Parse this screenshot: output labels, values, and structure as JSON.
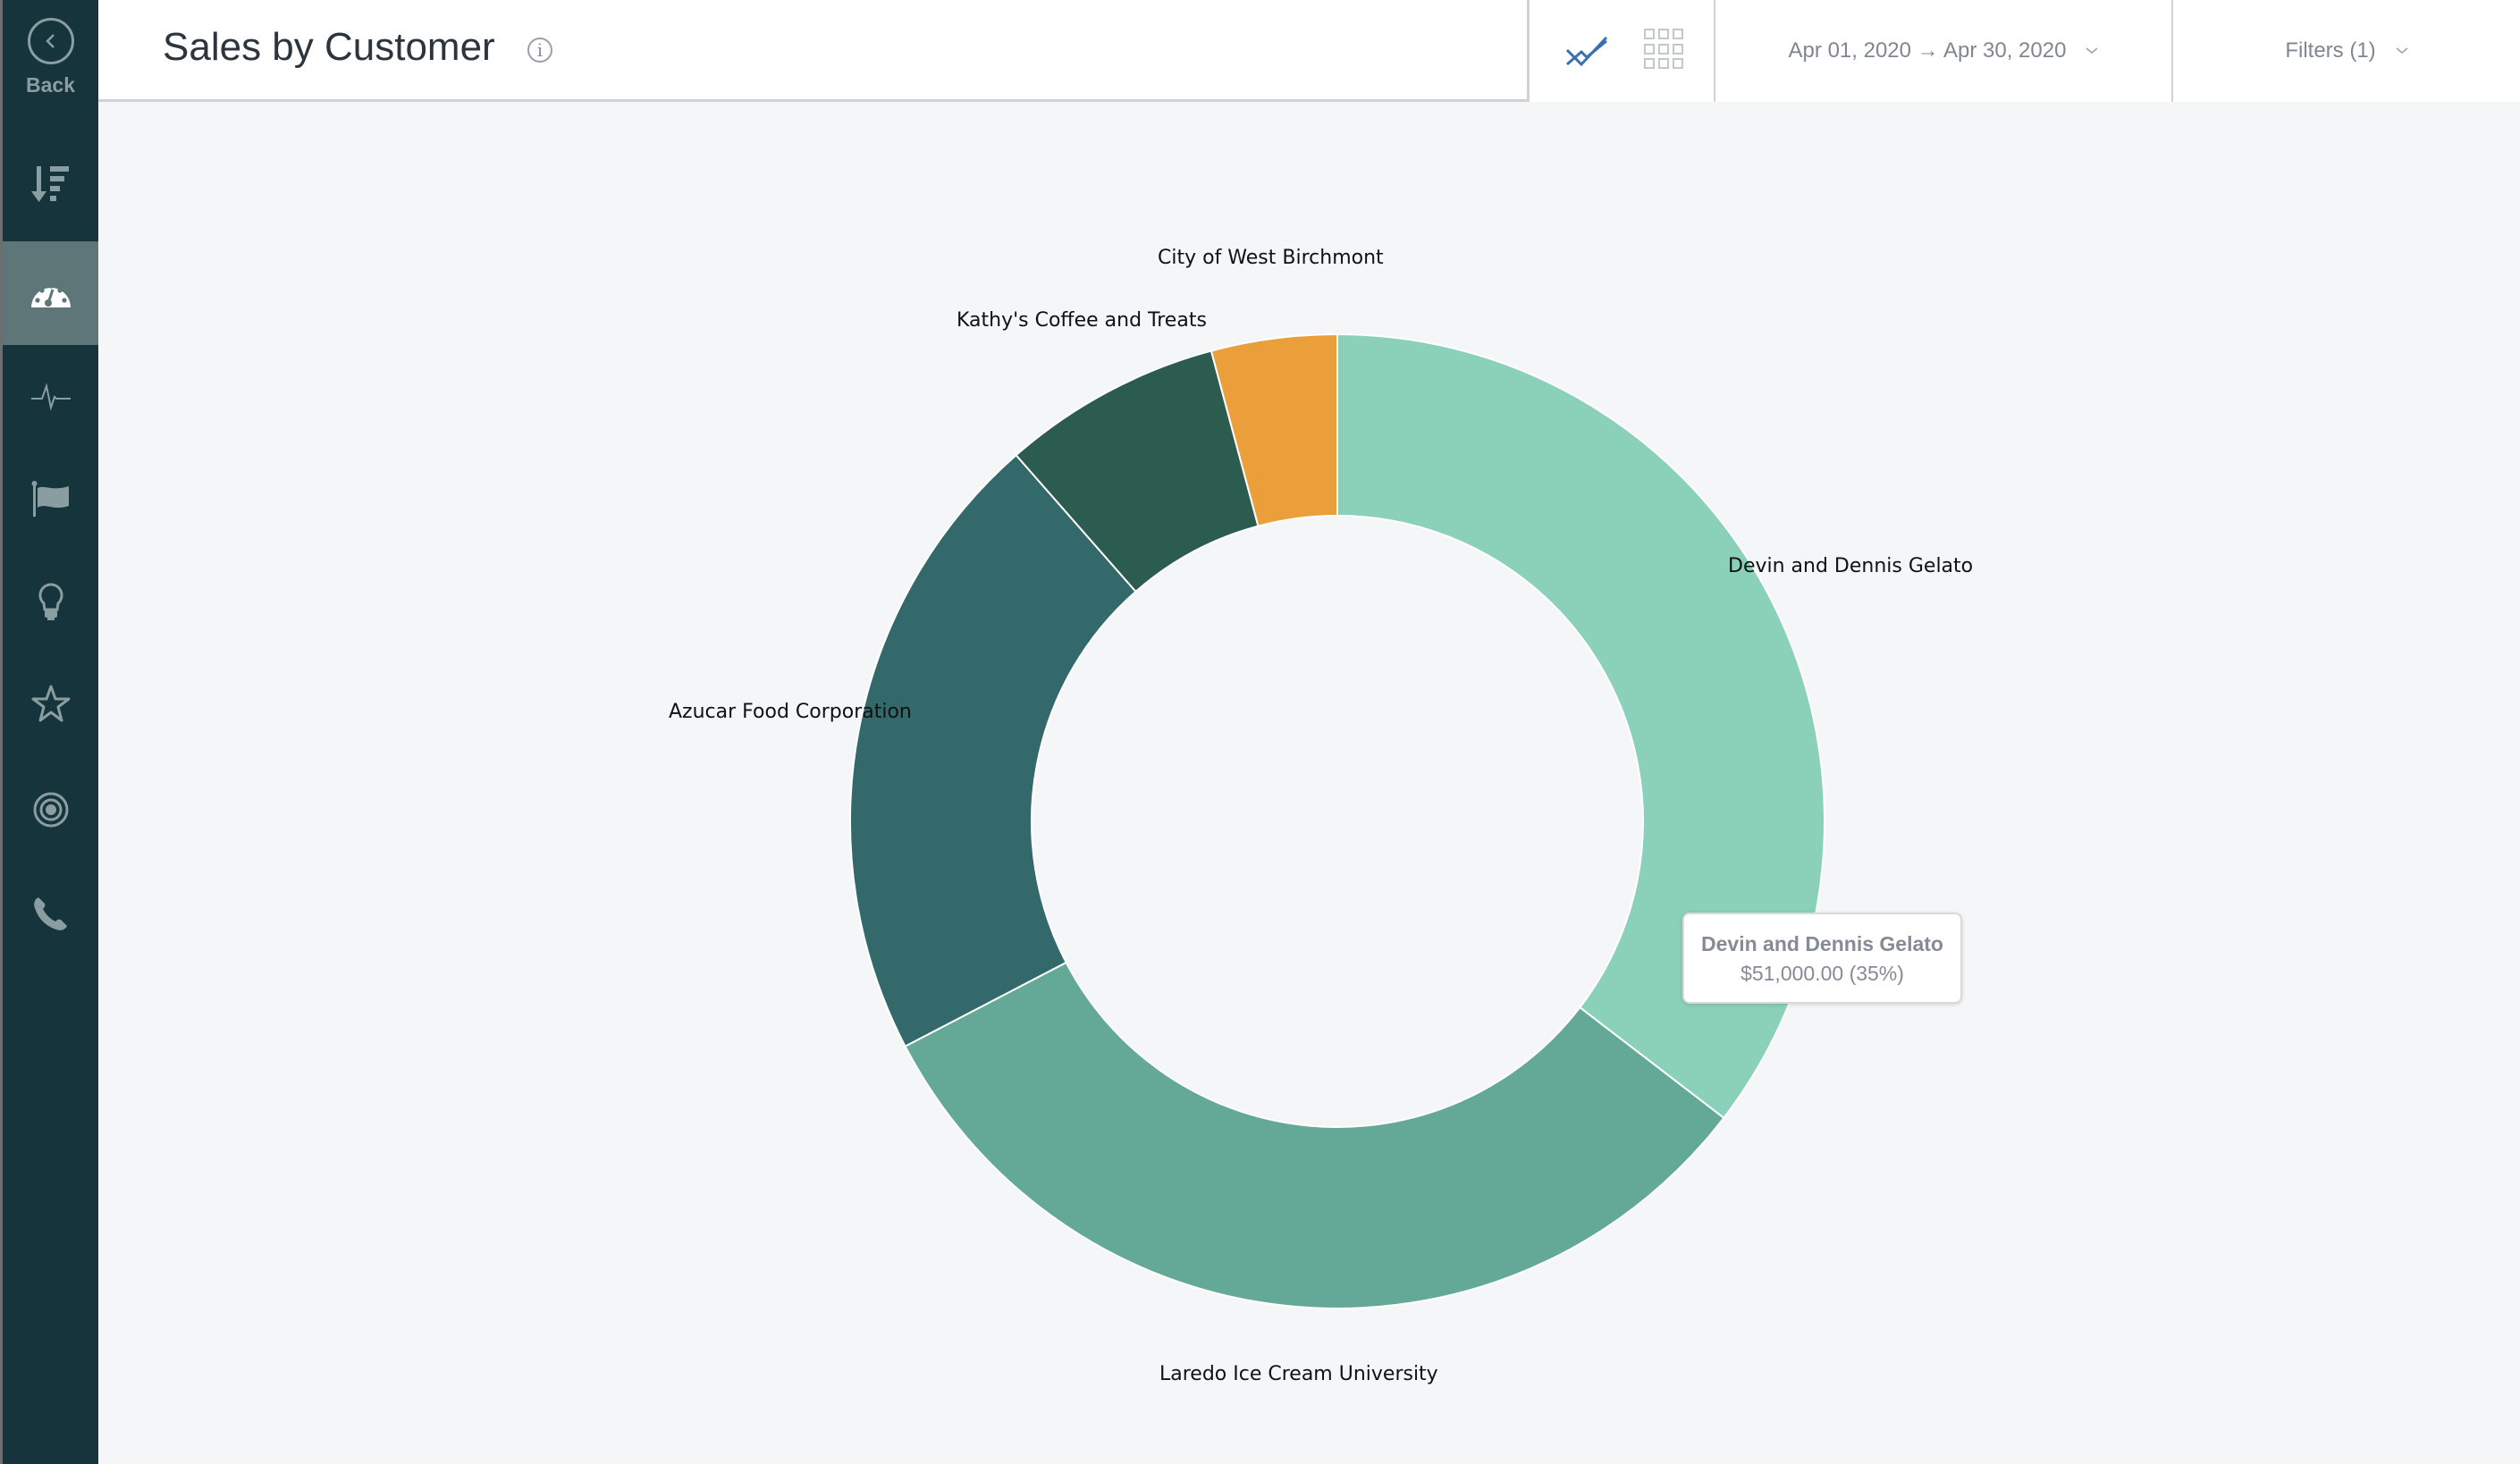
{
  "sidebar": {
    "back_label": "Back",
    "items": [
      {
        "icon": "sort-icon",
        "active": false
      },
      {
        "icon": "dashboard-gauge-icon",
        "active": true
      },
      {
        "icon": "activity-pulse-icon",
        "active": false
      },
      {
        "icon": "flag-icon",
        "active": false
      },
      {
        "icon": "lightbulb-icon",
        "active": false
      },
      {
        "icon": "star-icon",
        "active": false
      },
      {
        "icon": "target-icon",
        "active": false
      },
      {
        "icon": "phone-icon",
        "active": false
      }
    ]
  },
  "header": {
    "title": "Sales by Customer",
    "info_glyph": "i",
    "date_range": "Apr 01, 2020 → Apr 30, 2020",
    "filters_label": "Filters (1)",
    "view_modes": [
      "line-chart-icon",
      "grid-icon"
    ]
  },
  "colors": {
    "sidebar_bg": "#16343b",
    "sidebar_active": "#5e7677",
    "accent_blue": "#3a6fb0"
  },
  "tooltip": {
    "title": "Devin and Dennis Gelato",
    "value": "$51,000.00 (35%)"
  },
  "chart_data": {
    "type": "pie",
    "subtype": "donut",
    "title": "Sales by Customer",
    "categories": [
      "Devin and Dennis Gelato",
      "Laredo Ice Cream University",
      "Azucar Food Corporation",
      "Kathy's Coffee and Treats",
      "City of West Birchmont"
    ],
    "values": [
      51000,
      46000,
      30500,
      10500,
      6000
    ],
    "percentages": [
      35,
      32,
      21,
      7,
      4
    ],
    "colors": [
      "#8bd0b8",
      "#64a997",
      "#34696c",
      "#2c5b50",
      "#eb9f3a"
    ],
    "start_angle": "top, clockwise",
    "legend": "none (labels outside slices)"
  }
}
